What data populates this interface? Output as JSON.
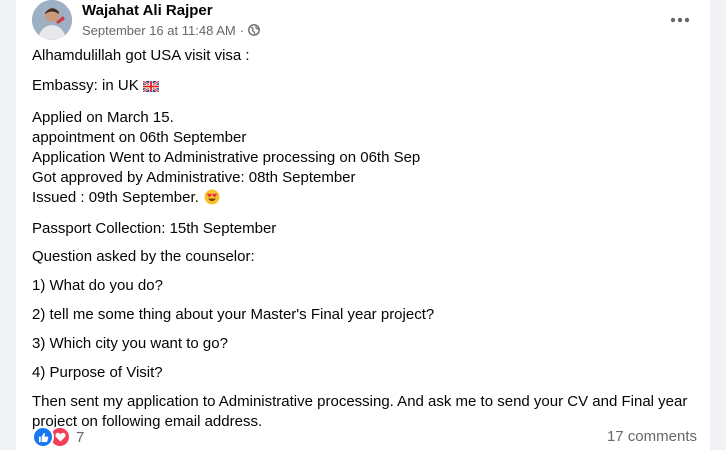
{
  "post": {
    "author": "Wajahat Ali Rajper",
    "timestamp": "September 16 at 11:48 AM",
    "separator": "·",
    "audience_icon": "globe-icon",
    "more_icon": "more-options-icon",
    "lines": {
      "l1": "Alhamdulillah got USA visit visa :",
      "l2": "Embassy: in UK",
      "l3": "Applied on March 15.",
      "l4": "appointment on 06th September",
      "l5": "Application Went to Administrative processing on 06th Sep",
      "l6": "Got approved by Administrative: 08th September",
      "l7": "Issued : 09th September.",
      "l8": "Passport Collection: 15th September",
      "l9": "Question asked by the counselor:",
      "l10": "1) What do you do?",
      "l11": "2) tell me some thing about your Master's Final year project?",
      "l12": "3) Which city you want to go?",
      "l13": "4) Purpose of Visit?",
      "l14": "Then sent my application to Administrative processing. And ask me to send your CV and Final year project on following email address."
    }
  },
  "footer": {
    "reaction_count": "7",
    "comments": "17 comments",
    "reaction_icons": [
      "like-icon",
      "love-icon"
    ]
  },
  "colors": {
    "accent": "#1877f2",
    "love": "#f33e58",
    "secondary_text": "#65676b"
  }
}
